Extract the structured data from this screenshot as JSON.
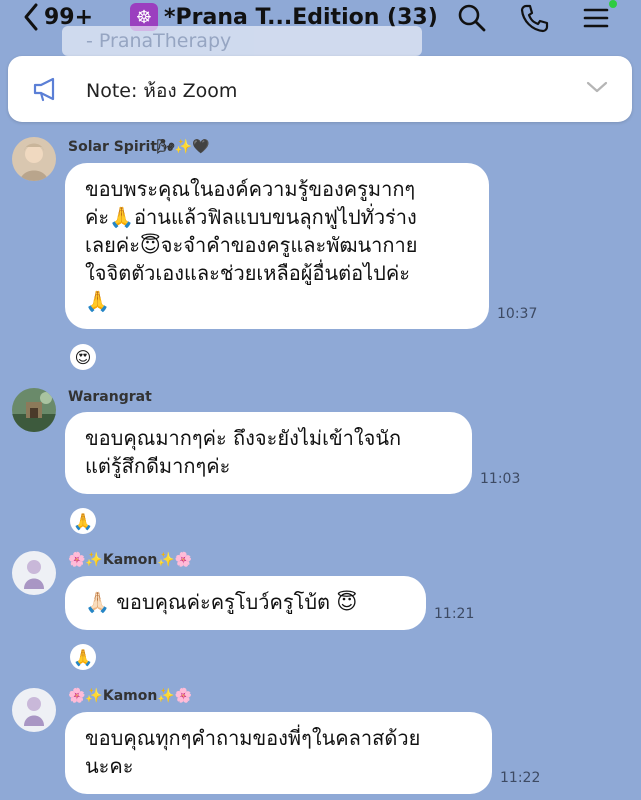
{
  "header": {
    "back_count": "99+",
    "room_icon": "☸",
    "title": "*Prana T...Edition (33)",
    "icons": [
      "search-icon",
      "phone-icon",
      "menu-icon"
    ]
  },
  "ghost_text": "- PranaTherapy",
  "note": {
    "text": "Note: ห้อง Zoom"
  },
  "messages": [
    {
      "sender": "Solar Spirit🌬✨🖤",
      "lines": [
        "ขอบพระคุณในองค์ความรู้ของครูมากๆ",
        "ค่ะ🙏อ่านแล้วฟิลแบบขนลุกฟูไปทั่วร่าง",
        "เลยค่ะ😇จะจำคำของครูและพัฒนากาย",
        "ใจจิตตัวเองและช่วยเหลือผู้อื่นต่อไปค่ะ",
        "🙏"
      ],
      "time": "10:37",
      "reaction": "😍"
    },
    {
      "sender": "Warangrat",
      "lines": [
        "ขอบคุณมากๆค่ะ  ถึงจะยังไม่เข้าใจนัก",
        "แต่รู้สึกดีมากๆค่ะ"
      ],
      "time": "11:03",
      "reaction": "🙏"
    },
    {
      "sender": "🌸✨Kamon✨🌸",
      "lines": [
        "🙏🏻 ขอบคุณค่ะครูโบว์ครูโบ้ต 😇"
      ],
      "time": "11:21",
      "reaction": "🙏"
    },
    {
      "sender": "🌸✨Kamon✨🌸",
      "lines": [
        "ขอบคุณทุกๆคำถามของพี่ๆในคลาสด้วย",
        "นะคะ"
      ],
      "time": "11:22"
    }
  ],
  "colors": {
    "background": "#8fa9d6",
    "bubble": "#ffffff",
    "note_icon": "#5b7fd6",
    "room_badge": "#9b3fbf",
    "online_dot": "#2ecc40"
  }
}
